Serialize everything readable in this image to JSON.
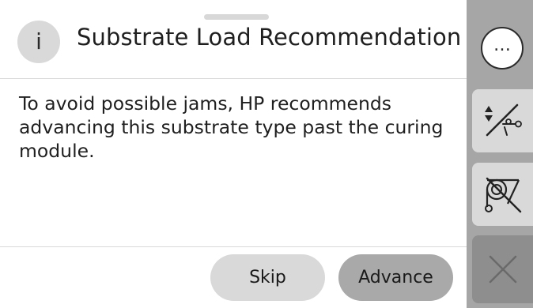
{
  "dialog": {
    "title": "Substrate Load Recommendation",
    "info_glyph": "i",
    "message": "To avoid possible jams, HP recommends advancing this substrate type past the curing module.",
    "buttons": {
      "skip_label": "Skip",
      "advance_label": "Advance"
    }
  },
  "side_rail": {
    "more_glyph": "…",
    "items": [
      {
        "icon": "more-options-icon",
        "enabled": true
      },
      {
        "icon": "advance-and-cut-icon",
        "enabled": true
      },
      {
        "icon": "unload-substrate-icon",
        "enabled": true
      },
      {
        "icon": "close-icon",
        "enabled": false
      }
    ]
  },
  "colors": {
    "background": "#ffffff",
    "rail": "#a6a6a6",
    "button_light": "#d9d9d9",
    "button_primary": "#a9a9a9",
    "disabled_button": "#8e8e8e",
    "text": "#1f1f1f"
  }
}
